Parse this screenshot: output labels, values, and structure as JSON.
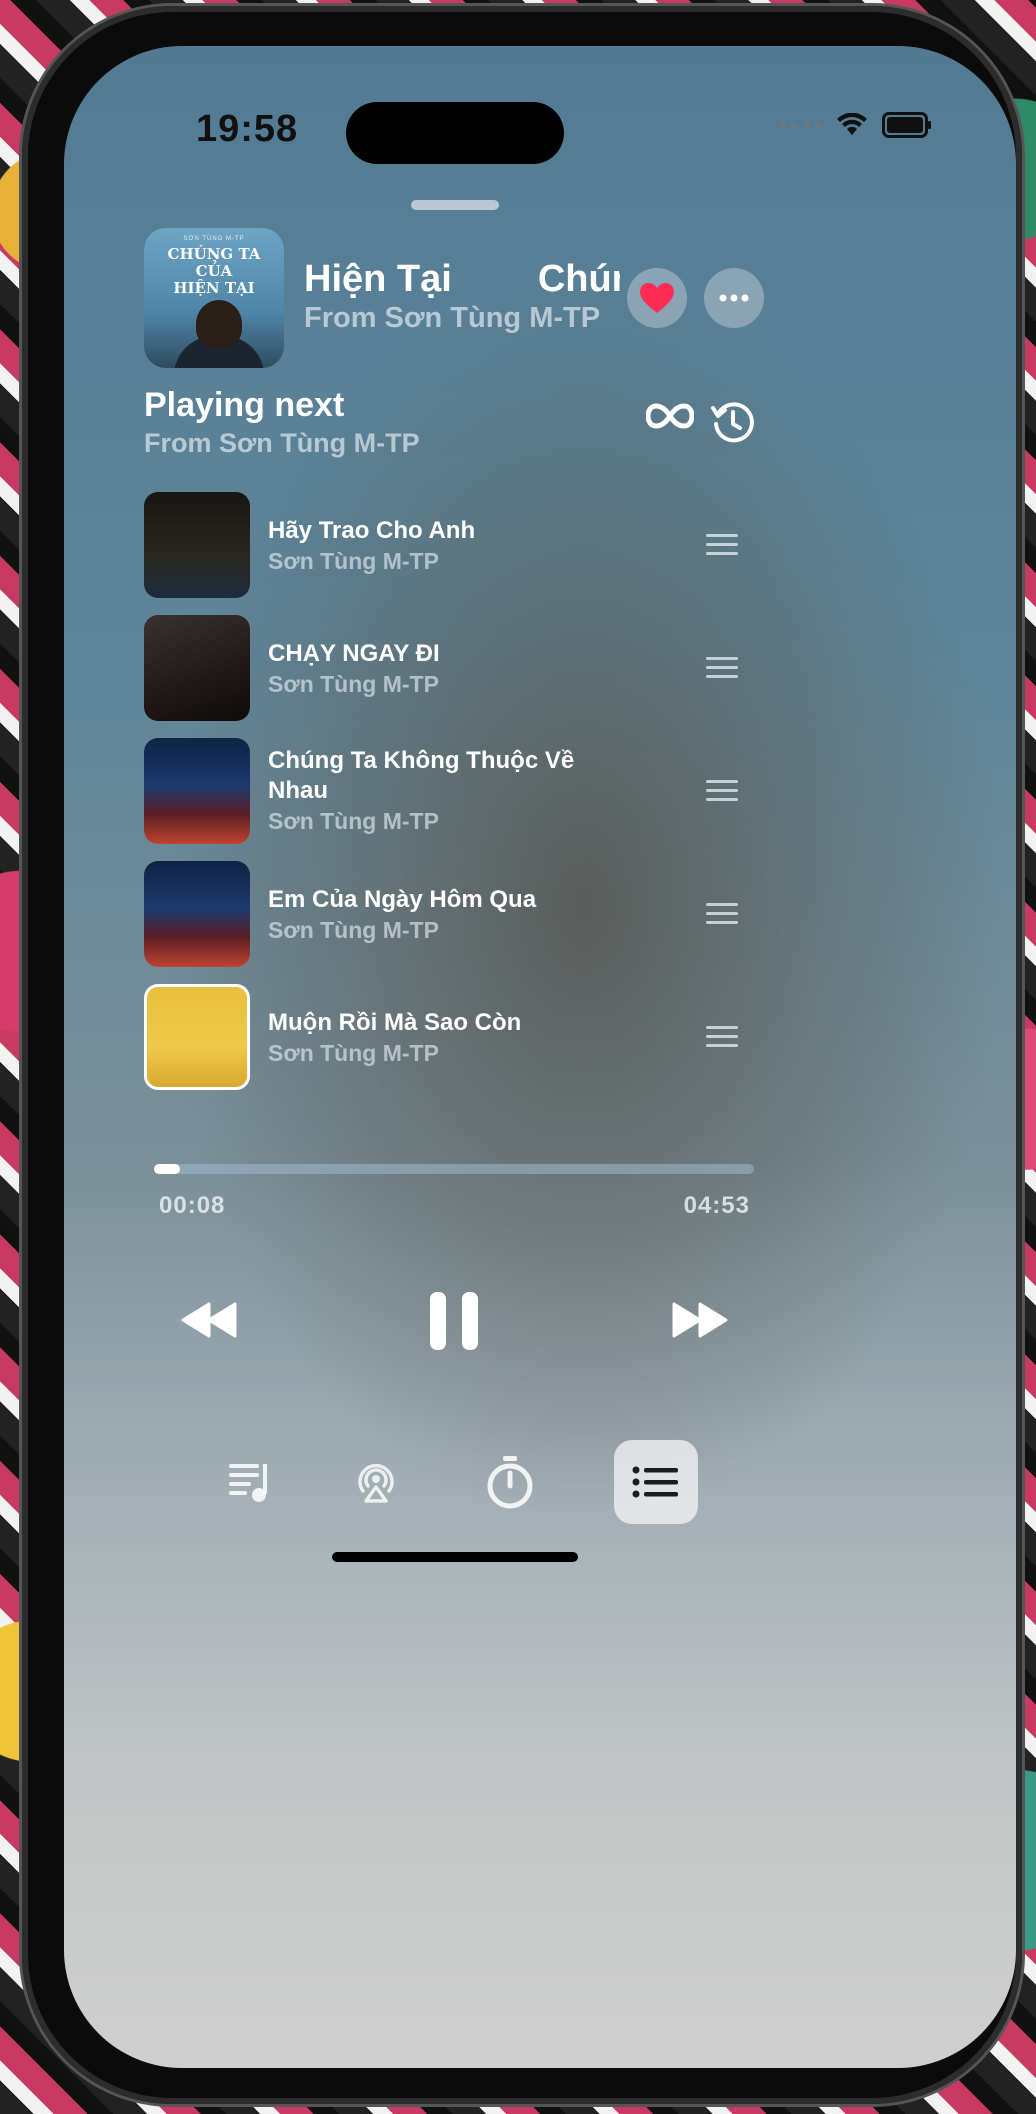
{
  "status_bar": {
    "time": "19:58"
  },
  "now_playing": {
    "title_parts": [
      "Hiện Tại",
      "Chún"
    ],
    "subtitle": "From Sơn Tùng M-TP",
    "album_art_text": {
      "artist": "SƠN TÙNG M-TP",
      "title_line1": "CHÚNG TA",
      "title_line2": "CỦA",
      "title_line3": "HIỆN TẠI"
    },
    "is_favorite": true,
    "heart_color": "#ff2d55"
  },
  "playing_next": {
    "title": "Playing next",
    "subtitle": "From Sơn Tùng M-TP"
  },
  "queue": [
    {
      "title": "Hãy Trao Cho Anh",
      "artist": "Sơn Tùng M-TP"
    },
    {
      "title": "CHẠY NGAY ĐI",
      "artist": "Sơn Tùng M-TP"
    },
    {
      "title": "Chúng Ta Không Thuộc Về Nhau",
      "artist": "Sơn Tùng M-TP"
    },
    {
      "title": "Em Của Ngày Hôm Qua",
      "artist": "Sơn Tùng M-TP"
    },
    {
      "title": "Muộn Rồi Mà Sao Còn",
      "artist": "Sơn Tùng M-TP"
    }
  ],
  "playback": {
    "elapsed": "00:08",
    "total": "04:53",
    "progress_fraction": 0.028,
    "state": "playing"
  },
  "bottom_bar": {
    "active": "queue"
  },
  "icons": {
    "heart": "heart-icon",
    "more": "ellipsis-icon",
    "infinity": "infinity-icon",
    "history": "history-icon",
    "drag": "drag-handle-icon",
    "rewind": "rewind-icon",
    "pause": "pause-icon",
    "forward": "fast-forward-icon",
    "lyrics": "lyrics-icon",
    "airplay": "airplay-icon",
    "timer": "timer-icon",
    "queue": "queue-list-icon"
  }
}
